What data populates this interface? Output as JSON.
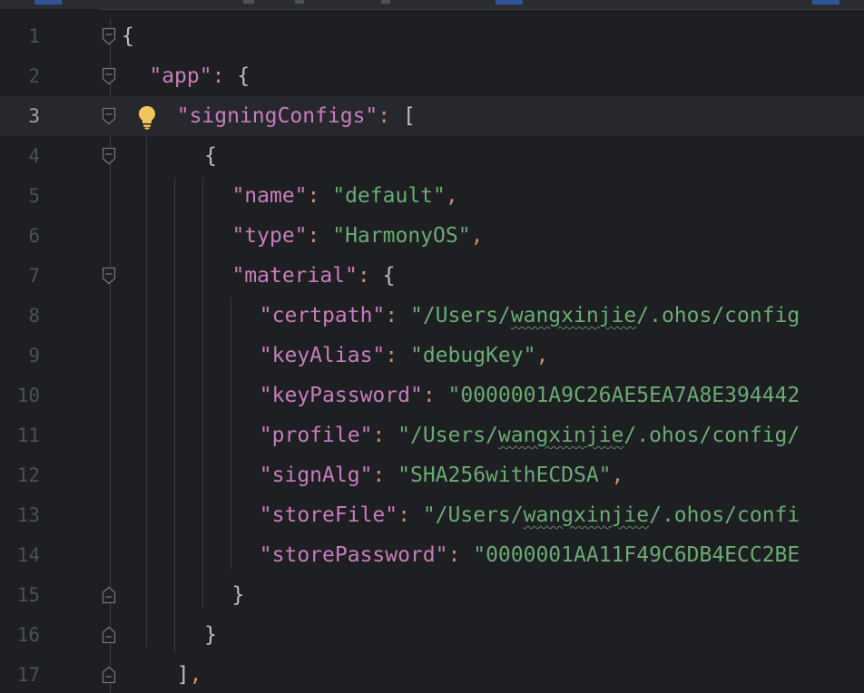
{
  "editor": {
    "lines": [
      {
        "no": "1",
        "tokens": [
          {
            "t": "punc",
            "v": "{"
          }
        ]
      },
      {
        "no": "2",
        "tokens": [
          {
            "t": "key",
            "v": "\"app\""
          },
          {
            "t": "colon",
            "v": ": "
          },
          {
            "t": "punc",
            "v": "{"
          }
        ]
      },
      {
        "no": "3",
        "tokens": [
          {
            "t": "key",
            "v": "\"signingConfigs\""
          },
          {
            "t": "colon",
            "v": ": "
          },
          {
            "t": "punc",
            "v": "["
          }
        ]
      },
      {
        "no": "4",
        "tokens": [
          {
            "t": "punc",
            "v": "{"
          }
        ]
      },
      {
        "no": "5",
        "tokens": [
          {
            "t": "key",
            "v": "\"name\""
          },
          {
            "t": "colon",
            "v": ": "
          },
          {
            "t": "str",
            "v": "\"default\""
          },
          {
            "t": "comma",
            "v": ","
          }
        ]
      },
      {
        "no": "6",
        "tokens": [
          {
            "t": "key",
            "v": "\"type\""
          },
          {
            "t": "colon",
            "v": ": "
          },
          {
            "t": "str",
            "v": "\"HarmonyOS\""
          },
          {
            "t": "comma",
            "v": ","
          }
        ]
      },
      {
        "no": "7",
        "tokens": [
          {
            "t": "key",
            "v": "\"material\""
          },
          {
            "t": "colon",
            "v": ": "
          },
          {
            "t": "punc",
            "v": "{"
          }
        ]
      },
      {
        "no": "8",
        "tokens": [
          {
            "t": "key",
            "v": "\"certpath\""
          },
          {
            "t": "colon",
            "v": ": "
          },
          {
            "t": "str",
            "v": "\"/Users/"
          },
          {
            "t": "str typo",
            "v": "wangxinjie"
          },
          {
            "t": "str",
            "v": "/.ohos/config"
          }
        ]
      },
      {
        "no": "9",
        "tokens": [
          {
            "t": "key",
            "v": "\"keyAlias\""
          },
          {
            "t": "colon",
            "v": ": "
          },
          {
            "t": "str",
            "v": "\"debugKey\""
          },
          {
            "t": "comma",
            "v": ","
          }
        ]
      },
      {
        "no": "10",
        "tokens": [
          {
            "t": "key",
            "v": "\"keyPassword\""
          },
          {
            "t": "colon",
            "v": ": "
          },
          {
            "t": "str",
            "v": "\"0000001A9C26AE5EA7A8E394442"
          }
        ]
      },
      {
        "no": "11",
        "tokens": [
          {
            "t": "key",
            "v": "\"profile\""
          },
          {
            "t": "colon",
            "v": ": "
          },
          {
            "t": "str",
            "v": "\"/Users/"
          },
          {
            "t": "str typo",
            "v": "wangxinjie"
          },
          {
            "t": "str",
            "v": "/.ohos/config/"
          }
        ]
      },
      {
        "no": "12",
        "tokens": [
          {
            "t": "key",
            "v": "\"signAlg\""
          },
          {
            "t": "colon",
            "v": ": "
          },
          {
            "t": "str",
            "v": "\"SHA256withECDSA\""
          },
          {
            "t": "comma",
            "v": ","
          }
        ]
      },
      {
        "no": "13",
        "tokens": [
          {
            "t": "key",
            "v": "\"storeFile\""
          },
          {
            "t": "colon",
            "v": ": "
          },
          {
            "t": "str",
            "v": "\"/Users/"
          },
          {
            "t": "str typo",
            "v": "wangxinjie"
          },
          {
            "t": "str",
            "v": "/.ohos/confi"
          }
        ]
      },
      {
        "no": "14",
        "tokens": [
          {
            "t": "key",
            "v": "\"storePassword\""
          },
          {
            "t": "colon",
            "v": ": "
          },
          {
            "t": "str",
            "v": "\"0000001AA11F49C6DB4ECC2BE"
          }
        ]
      },
      {
        "no": "15",
        "tokens": [
          {
            "t": "punc",
            "v": "}"
          }
        ]
      },
      {
        "no": "16",
        "tokens": [
          {
            "t": "punc",
            "v": "}"
          }
        ]
      },
      {
        "no": "17",
        "tokens": [
          {
            "t": "punc",
            "v": "]"
          },
          {
            "t": "comma",
            "v": ","
          }
        ]
      }
    ],
    "current_line": "3",
    "icons": {
      "intention_bulb": "lightbulb-icon",
      "fold_open": "fold-open-icon",
      "fold_close": "fold-close-icon"
    },
    "colors": {
      "background": "#1e1f22",
      "key": "#c77dbb",
      "string": "#6aab73",
      "punctuation": "#bcbec4",
      "colon": "#cf8e6d",
      "line_number": "#4b5059",
      "bulb": "#f2c55c"
    }
  }
}
